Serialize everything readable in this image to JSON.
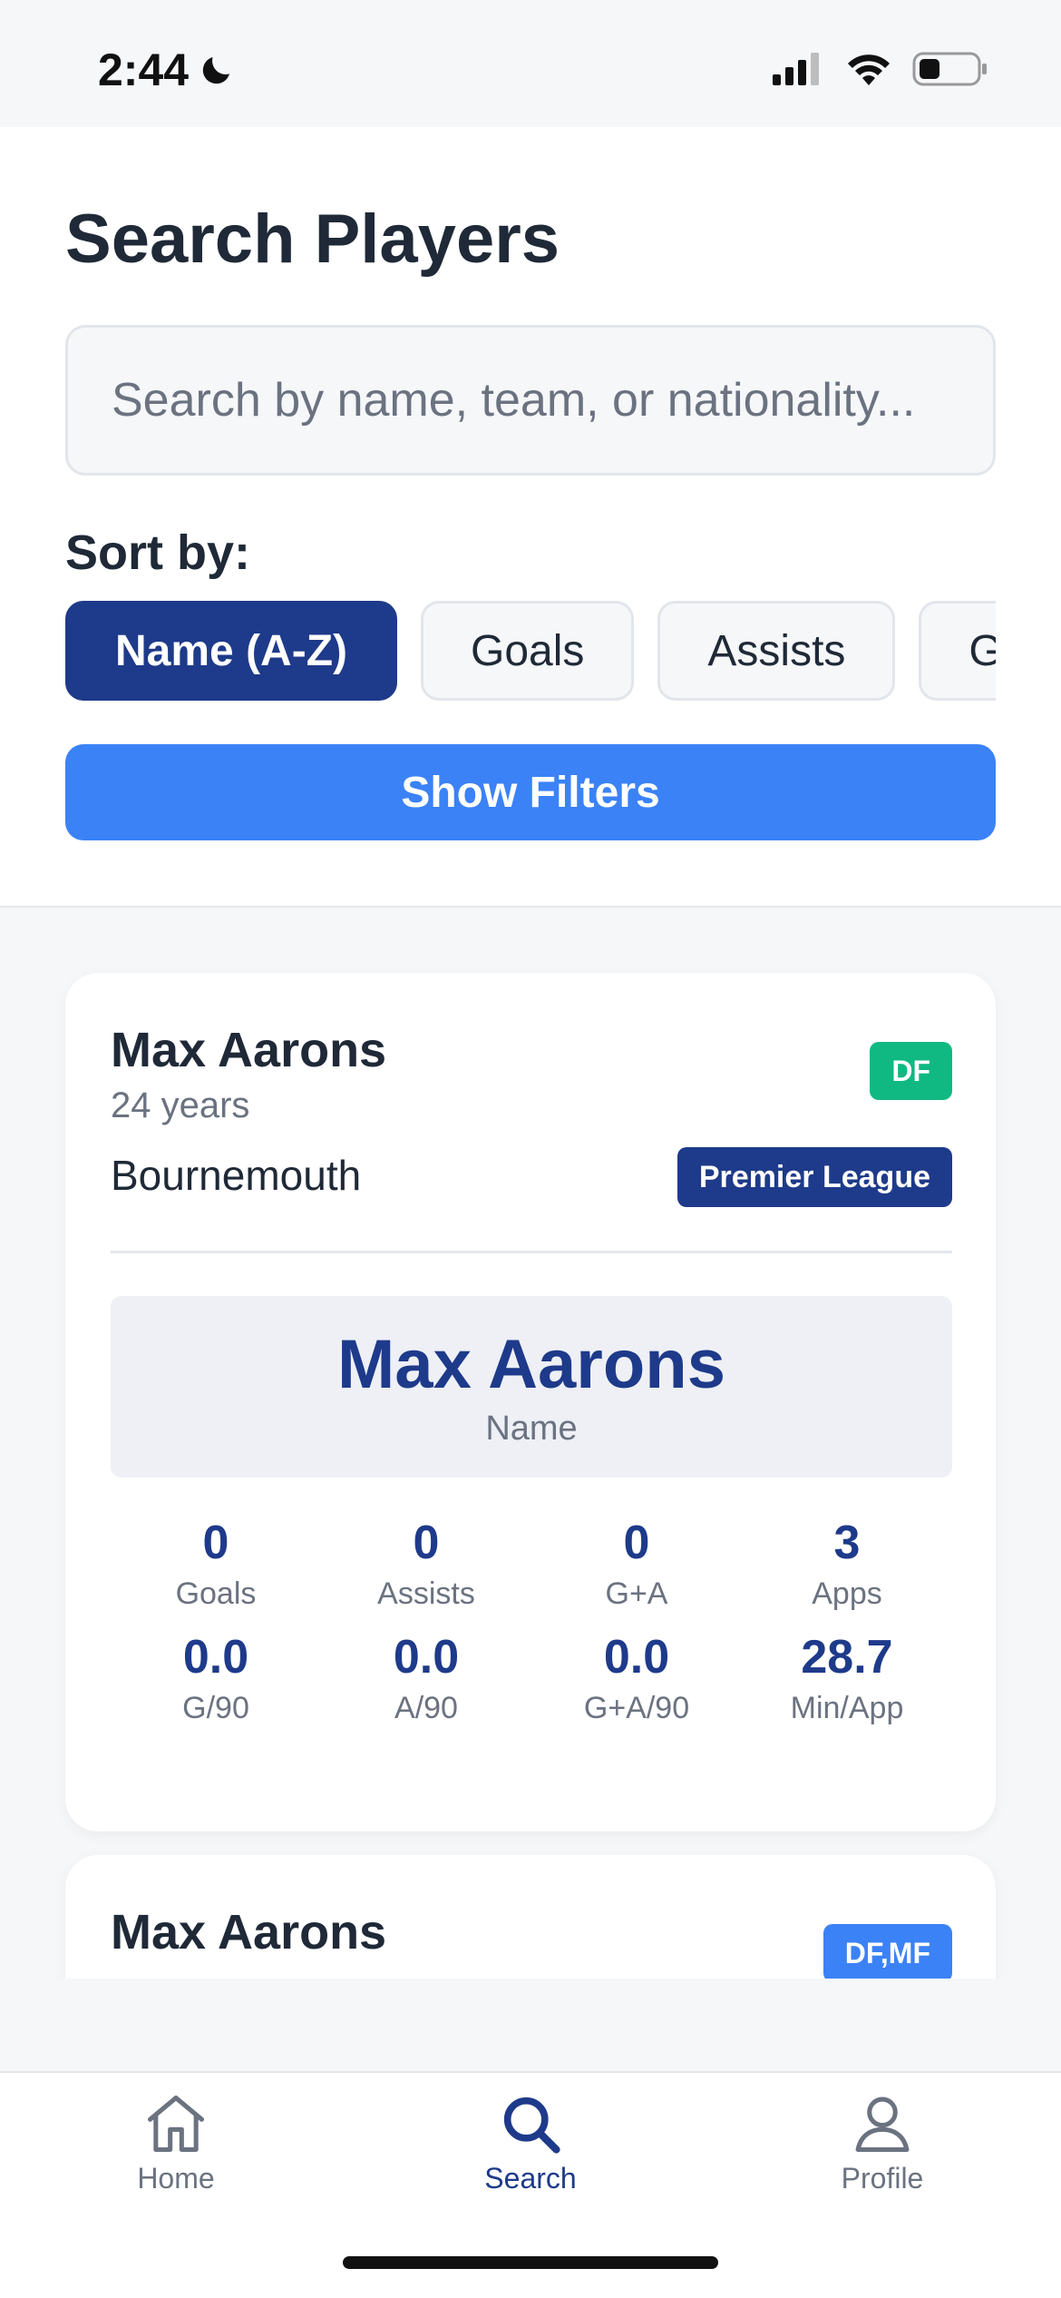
{
  "status_bar": {
    "time": "2:44"
  },
  "header": {
    "title": "Search Players",
    "search_placeholder": "Search by name, team, or nationality...",
    "sort_label": "Sort by:",
    "sort_options": [
      "Name (A-Z)",
      "Goals",
      "Assists",
      "Go"
    ],
    "active_sort": "Name (A-Z)",
    "filters_button": "Show Filters"
  },
  "players": [
    {
      "name": "Max Aarons",
      "age": "24 years",
      "team": "Bournemouth",
      "position": "DF",
      "position_color": "#10B981",
      "league": "Premier League",
      "highlight": {
        "value": "Max Aarons",
        "label": "Name"
      },
      "stats": [
        {
          "value": "0",
          "label": "Goals"
        },
        {
          "value": "0",
          "label": "Assists"
        },
        {
          "value": "0",
          "label": "G+A"
        },
        {
          "value": "3",
          "label": "Apps"
        },
        {
          "value": "0.0",
          "label": "G/90"
        },
        {
          "value": "0.0",
          "label": "A/90"
        },
        {
          "value": "0.0",
          "label": "G+A/90"
        },
        {
          "value": "28.7",
          "label": "Min/App"
        }
      ]
    },
    {
      "name": "Max Aarons",
      "position": "DF,MF",
      "position_color": "#3B82F6"
    }
  ],
  "tabs": [
    {
      "label": "Home",
      "icon": "home-icon"
    },
    {
      "label": "Search",
      "icon": "search-icon",
      "active": true
    },
    {
      "label": "Profile",
      "icon": "profile-icon"
    }
  ],
  "colors": {
    "primary": "#1E3A8A",
    "accent": "#3B82F6",
    "df": "#10B981"
  }
}
